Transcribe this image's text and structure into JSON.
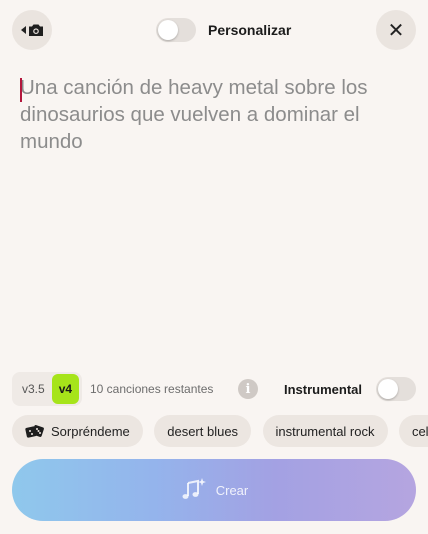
{
  "header": {
    "personalize_label": "Personalizar",
    "personalize_on": false,
    "close_symbol": "✕"
  },
  "prompt": {
    "placeholder": "Una canción de heavy metal sobre los dinosaurios que vuelven a dominar el mundo"
  },
  "models": [
    {
      "label": "v3.5",
      "active": false
    },
    {
      "label": "v4",
      "active": true
    }
  ],
  "remaining_text": "10 canciones restantes",
  "info_symbol": "i",
  "instrumental": {
    "label": "Instrumental",
    "on": false
  },
  "chips": {
    "surprise_label": "Sorpréndeme",
    "genres": [
      "desert blues",
      "instrumental rock",
      "celtic n"
    ]
  },
  "create_label": "Crear",
  "colors": {
    "accent_version": "#a6e41a",
    "cursor": "#b3163c"
  },
  "icons": [
    "camera-icon",
    "close-icon",
    "info-icon",
    "dice-icon",
    "music-note-sparkle-icon"
  ]
}
